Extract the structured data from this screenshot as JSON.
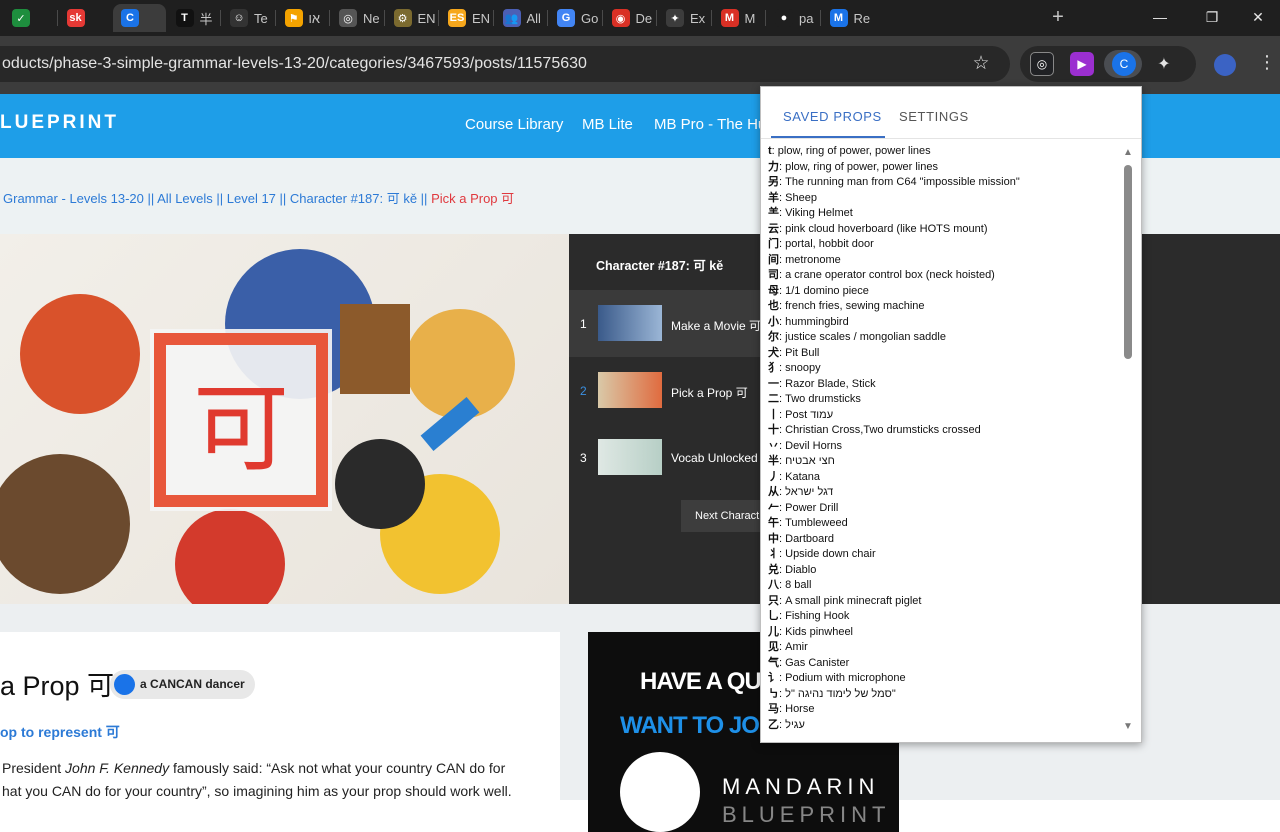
{
  "browser": {
    "tabs": [
      {
        "label": "",
        "icon": "check-icon",
        "color": "#1e8e3e",
        "glyph": "✓"
      },
      {
        "label": "",
        "icon": "sk-icon",
        "color": "#e53935",
        "glyph": "sk"
      },
      {
        "label": "",
        "icon": "c-icon",
        "color": "#1a73e8",
        "glyph": "C"
      },
      {
        "label": "半",
        "icon": "t-icon",
        "color": "#111111",
        "glyph": "T"
      },
      {
        "label": "Te",
        "icon": "face-icon",
        "color": "#333333",
        "glyph": "☺"
      },
      {
        "label": "או",
        "icon": "flag-icon",
        "color": "#f4a300",
        "glyph": "⚑"
      },
      {
        "label": "Ne",
        "icon": "globe-icon",
        "color": "#555555",
        "glyph": "◎"
      },
      {
        "label": "EN",
        "icon": "shield-icon",
        "color": "#7b6a2f",
        "glyph": "⚙"
      },
      {
        "label": "EN",
        "icon": "es-icon",
        "color": "#f6a71c",
        "glyph": "ES"
      },
      {
        "label": "All",
        "icon": "people-icon",
        "color": "#4b5fb5",
        "glyph": "👥"
      },
      {
        "label": "Go",
        "icon": "translate-icon",
        "color": "#4285f4",
        "glyph": "G"
      },
      {
        "label": "De",
        "icon": "chrome-icon",
        "color": "#d93025",
        "glyph": "◉"
      },
      {
        "label": "Ex",
        "icon": "puzzle-icon",
        "color": "#3c3c3c",
        "glyph": "✦"
      },
      {
        "label": "M",
        "icon": "m-icon",
        "color": "#d93025",
        "glyph": "M"
      },
      {
        "label": "pa",
        "icon": "github-icon",
        "color": "#1f1f1f",
        "glyph": "●"
      },
      {
        "label": "Re",
        "icon": "re-icon",
        "color": "#1a73e8",
        "glyph": "M"
      }
    ],
    "url": "oducts/phase-3-simple-grammar-levels-13-20/categories/3467593/posts/11575630",
    "window_controls": {
      "minimize": "—",
      "restore": "❐",
      "close": "✕"
    }
  },
  "site": {
    "logo": "LUEPRINT",
    "nav": [
      "Course Library",
      "MB Lite",
      "MB Pro - The Hu"
    ],
    "breadcrumbs": {
      "trail": "Grammar - Levels 13-20 || All Levels || Level 17 || Character #187: 可 kě ||",
      "current": "Pick a Prop 可"
    },
    "hero_char": "可",
    "panel": {
      "title": "Character #187: 可 kě",
      "lessons": [
        {
          "num": "1",
          "title": "Make a Movie 可"
        },
        {
          "num": "2",
          "title": "Pick a Prop 可"
        },
        {
          "num": "3",
          "title": "Vocab Unlocked f"
        }
      ],
      "next_button": "Next Charact"
    },
    "content": {
      "title": "a Prop 可",
      "badge": "a CANCAN dancer",
      "subtitle": "op to represent 可",
      "body_1_pre": "President ",
      "body_1_em": "John F. Kennedy",
      "body_1_post": " famously said: “Ask not what your country CAN do for",
      "body_2": "hat you CAN do for your country”, so imagining him as your prop should work well."
    },
    "ad": {
      "line1": "HAVE A QUESTION?",
      "line2": "WANT TO JOIN A LIVE",
      "brand": "MANDARIN",
      "brand2": "BLUEPRINT"
    }
  },
  "popup": {
    "tabs": [
      "SAVED PROPS",
      "SETTINGS"
    ],
    "props": [
      {
        "char": "t",
        "text": "plow, ring of power, power lines"
      },
      {
        "char": "力",
        "text": "plow, ring of power, power lines"
      },
      {
        "char": "另",
        "text": "The running man from C64 \"impossible mission\""
      },
      {
        "char": "羊",
        "text": "Sheep"
      },
      {
        "char": "⺷",
        "text": "Viking Helmet"
      },
      {
        "char": "云",
        "text": "pink cloud hoverboard (like HOTS mount)"
      },
      {
        "char": "门",
        "text": "portal, hobbit door"
      },
      {
        "char": "间",
        "text": "metronome"
      },
      {
        "char": "司",
        "text": "a crane operator control box (neck hoisted)"
      },
      {
        "char": "母",
        "text": "1/1 domino piece"
      },
      {
        "char": "也",
        "text": "french fries, sewing machine"
      },
      {
        "char": "小",
        "text": "hummingbird"
      },
      {
        "char": "尔",
        "text": "justice scales / mongolian saddle"
      },
      {
        "char": "犬",
        "text": "Pit Bull"
      },
      {
        "char": "犭",
        "text": "snoopy"
      },
      {
        "char": "一",
        "text": "Razor Blade, Stick"
      },
      {
        "char": "二",
        "text": "Two drumsticks"
      },
      {
        "char": "丨",
        "text": "Post עמוד"
      },
      {
        "char": "十",
        "text": "Christian Cross,Two drumsticks crossed"
      },
      {
        "char": "丷",
        "text": "Devil Horns"
      },
      {
        "char": "半",
        "text": "חצי אבטיח"
      },
      {
        "char": "丿",
        "text": "Katana"
      },
      {
        "char": "从",
        "text": "דגל ישראל"
      },
      {
        "char": "𠂉",
        "text": "Power Drill"
      },
      {
        "char": "午",
        "text": "Tumbleweed"
      },
      {
        "char": "中",
        "text": "Dartboard"
      },
      {
        "char": "丬",
        "text": "Upside down chair"
      },
      {
        "char": "兑",
        "text": "Diablo"
      },
      {
        "char": "八",
        "text": "8 ball"
      },
      {
        "char": "只",
        "text": "A small pink minecraft piglet"
      },
      {
        "char": "乚",
        "text": "Fishing Hook"
      },
      {
        "char": "儿",
        "text": "Kids pinwheel"
      },
      {
        "char": "见",
        "text": "Amir"
      },
      {
        "char": "气",
        "text": "Gas Canister"
      },
      {
        "char": "讠",
        "text": "Podium with microphone"
      },
      {
        "char": "㇉",
        "text": "סמל של לימוד נהיגה \"ל\""
      },
      {
        "char": "马",
        "text": "Horse"
      },
      {
        "char": "乙",
        "text": "עגיל"
      }
    ]
  },
  "colors": {
    "site_blue": "#1e9ee8",
    "link_blue": "#2c7ad6",
    "current_red": "#e0393e",
    "popup_tab_blue": "#3a6fc4",
    "panel_dark": "#2b2b2b",
    "chrome_dark": "#1f1f1f"
  }
}
